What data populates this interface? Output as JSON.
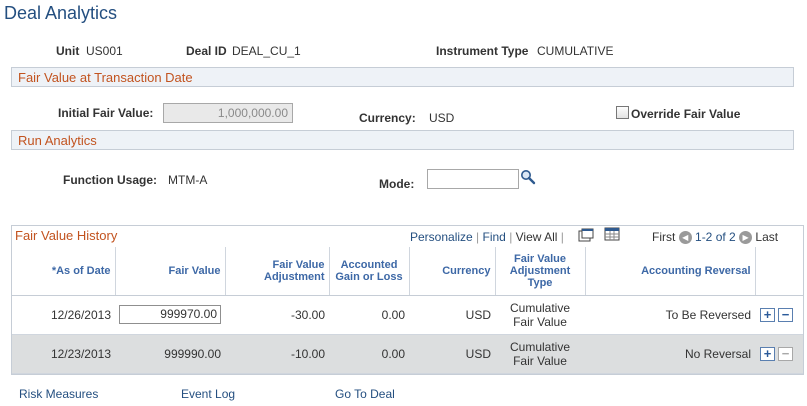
{
  "page": {
    "title": "Deal Analytics"
  },
  "header": {
    "unit_label": "Unit",
    "unit_value": "US001",
    "deal_id_label": "Deal ID",
    "deal_id_value": "DEAL_CU_1",
    "instrument_type_label": "Instrument Type",
    "instrument_type_value": "CUMULATIVE"
  },
  "fair_value_section": {
    "title": "Fair Value at Transaction Date",
    "initial_fair_value_label": "Initial Fair Value:",
    "initial_fair_value": "1,000,000.00",
    "currency_label": "Currency:",
    "currency_value": "USD",
    "override_label": "Override Fair Value",
    "override_checked": false
  },
  "run_analytics": {
    "title": "Run Analytics",
    "function_usage_label": "Function Usage:",
    "function_usage_value": "MTM-A",
    "mode_label": "Mode:",
    "mode_value": ""
  },
  "history": {
    "title": "Fair Value History",
    "personalize": "Personalize",
    "find": "Find",
    "view_all": "View All",
    "first": "First",
    "range": "1-2 of 2",
    "last": "Last",
    "columns": {
      "as_of_date": "*As of Date",
      "fair_value": "Fair Value",
      "fv_adjustment": "Fair Value Adjustment",
      "gain_loss": "Accounted Gain or Loss",
      "currency": "Currency",
      "fv_adj_type": "Fair Value Adjustment Type",
      "acct_reversal": "Accounting Reversal"
    },
    "rows": [
      {
        "as_of_date": "12/26/2013",
        "fair_value": "999970.00",
        "fv_adjustment": "-30.00",
        "gain_loss": "0.00",
        "currency": "USD",
        "fv_adj_type": "Cumulative Fair Value",
        "acct_reversal": "To Be Reversed"
      },
      {
        "as_of_date": "12/23/2013",
        "fair_value": "999990.00",
        "fv_adjustment": "-10.00",
        "gain_loss": "0.00",
        "currency": "USD",
        "fv_adj_type": "Cumulative Fair Value",
        "acct_reversal": "No Reversal"
      }
    ]
  },
  "footer_links": {
    "risk_measures": "Risk Measures",
    "event_log": "Event Log",
    "go_to_deal": "Go To Deal"
  },
  "colors": {
    "section_title": "#c2531f",
    "link": "#244f80",
    "header_text": "#3d68a6",
    "alt_row": "#dcdedf"
  }
}
